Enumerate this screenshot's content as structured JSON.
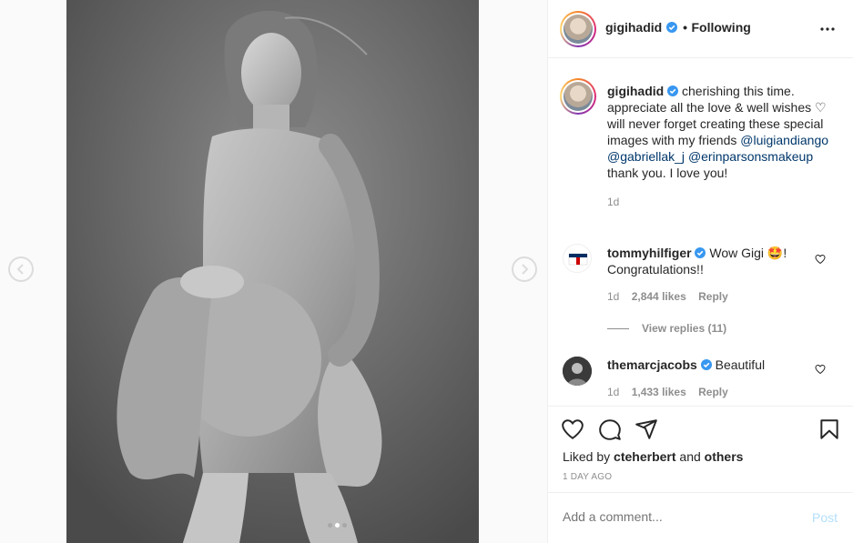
{
  "post": {
    "username": "gigihadid",
    "follow_status": "Following",
    "separator": "•",
    "caption_text": "cherishing this time. appreciate all the love & well wishes ♡ will never forget creating these special images with my friends",
    "mention_1": "@luigiandiango",
    "mention_2": "@gabriellak_j",
    "mention_3": "@erinparsonsmakeup",
    "caption_end": "thank you. I love you!",
    "caption_age": "1d"
  },
  "comments": [
    {
      "username": "tommyhilfiger",
      "text_1": "Wow Gigi",
      "emoji": "🤩",
      "text_2": "! Congratulations!!",
      "age": "1d",
      "likes": "2,844 likes",
      "reply": "Reply",
      "view_replies": "View replies (11)"
    },
    {
      "username": "themarcjacobs",
      "text_1": "Beautiful",
      "age": "1d",
      "likes": "1,433 likes",
      "reply": "Reply"
    }
  ],
  "footer": {
    "liked_by_prefix": "Liked by",
    "liked_by_user": "cteherbert",
    "liked_by_and": "and",
    "liked_by_others": "others",
    "date": "1 DAY AGO",
    "comment_placeholder": "Add a comment...",
    "post_label": "Post"
  },
  "carousel": {
    "count": 3,
    "active_index": 1
  },
  "colors": {
    "verified": "#3897f0",
    "link": "#00376b",
    "post_disabled": "#b2dffc",
    "muted": "#8e8e8e"
  }
}
